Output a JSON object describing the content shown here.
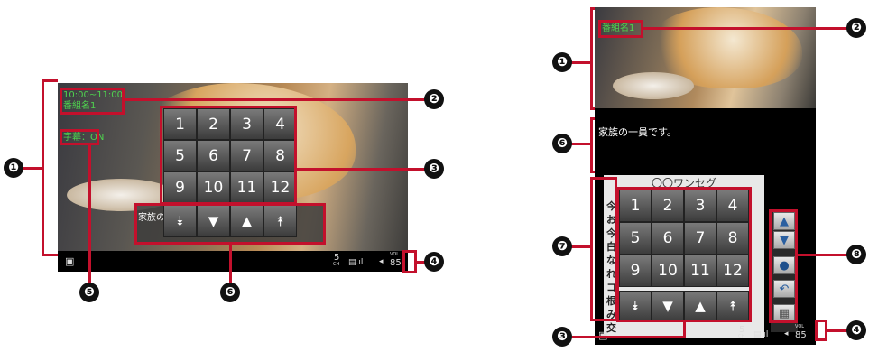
{
  "landscape": {
    "time": "10:00~11:00",
    "program": "番組名1",
    "subtitle_status": "字幕：ON",
    "caption": "家族の一員です。",
    "keys": [
      "1",
      "2",
      "3",
      "4",
      "5",
      "6",
      "7",
      "8",
      "9",
      "10",
      "11",
      "12"
    ],
    "arrows": [
      "⯯",
      "▼",
      "▲",
      "⯭"
    ],
    "status_ch": "5",
    "status_ch_sub": "CH",
    "status_icons": "▤.ıl",
    "status_vol": "◂",
    "status_level": "85",
    "status_level_sub": "VOL"
  },
  "portrait": {
    "program": "番組名1",
    "caption": "家族の一員です。",
    "epg_header": "〇〇ワンセグ",
    "epg_chars": [
      "今",
      "お",
      "今",
      "白",
      "な",
      "れ",
      "コ",
      "根",
      "み",
      "交"
    ],
    "keys": [
      "1",
      "2",
      "3",
      "4",
      "5",
      "6",
      "7",
      "8",
      "9",
      "10",
      "11",
      "12"
    ],
    "arrows": [
      "⯯",
      "▼",
      "▲",
      "⯭"
    ],
    "side_buttons": [
      "▲",
      "▼",
      "●",
      "↶",
      "▦"
    ],
    "status_ch": "5",
    "status_ch_sub": "CH",
    "status_icons": "▤.ıl",
    "status_vol": "◂",
    "status_level": "85",
    "status_level_sub": "VOL"
  },
  "callouts": {
    "n1": "❶",
    "n2": "❷",
    "n3": "❸",
    "n4": "❹",
    "n5": "❺",
    "n6": "❻",
    "n7": "❼",
    "n8": "❽"
  },
  "colors": {
    "accent": "#c3102c",
    "text_green": "#4fd34f"
  }
}
